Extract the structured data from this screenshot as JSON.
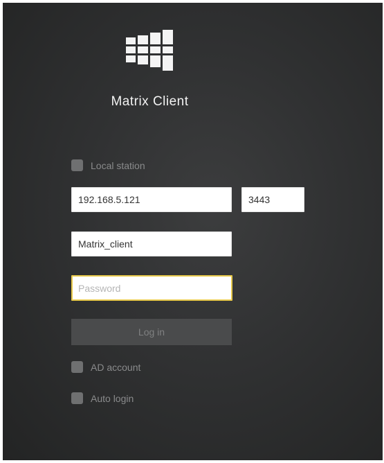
{
  "app": {
    "title": "Matrix Client",
    "logo_icon": "windows-grid-logo"
  },
  "local_station": {
    "label": "Local station",
    "checked": false
  },
  "server": {
    "address": "192.168.5.121",
    "port": "3443"
  },
  "username": {
    "value": "Matrix_client"
  },
  "password": {
    "placeholder": "Password",
    "value": ""
  },
  "login_button": {
    "label": "Log in"
  },
  "ad_account": {
    "label": "AD account",
    "checked": false
  },
  "auto_login": {
    "label": "Auto login",
    "checked": false
  },
  "colors": {
    "background": "#303132",
    "focus_border": "#e8c94a",
    "checkbox": "#6f7071"
  }
}
